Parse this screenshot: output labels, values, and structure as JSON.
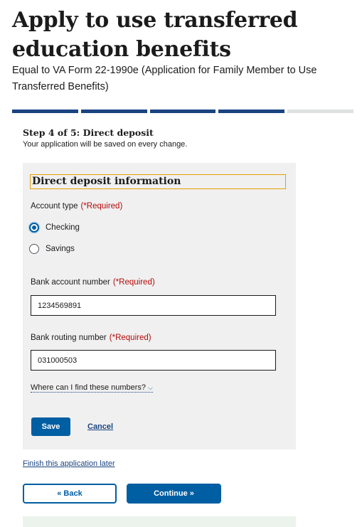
{
  "page": {
    "title": "Apply to use transferred education benefits",
    "subtitle": "Equal to VA Form 22-1990e (Application for Family Member to Use Transferred Benefits)"
  },
  "progress": {
    "total_steps": 5,
    "current_step": 4
  },
  "step": {
    "title": "Step 4 of 5: Direct deposit",
    "note": "Your application will be saved on every change."
  },
  "form": {
    "heading": "Direct deposit information",
    "required_marker": "(*Required)",
    "account_type": {
      "label": "Account type",
      "options": [
        "Checking",
        "Savings"
      ],
      "selected": "Checking"
    },
    "account_number": {
      "label": "Bank account number",
      "value": "1234569891"
    },
    "routing_number": {
      "label": "Bank routing number",
      "value": "031000503"
    },
    "help_link": "Where can I find these numbers?",
    "save_label": "Save",
    "cancel_label": "Cancel"
  },
  "footer": {
    "finish_later": "Finish this application later",
    "back_label": "« Back",
    "continue_label": "Continue »"
  },
  "colors": {
    "primary": "#005ea2",
    "progress_done": "#1a4480",
    "progress_todo": "#dfe1e2",
    "required": "#b50909",
    "panel_bg": "#f0f0f0",
    "focus_outline": "#e5a000"
  }
}
